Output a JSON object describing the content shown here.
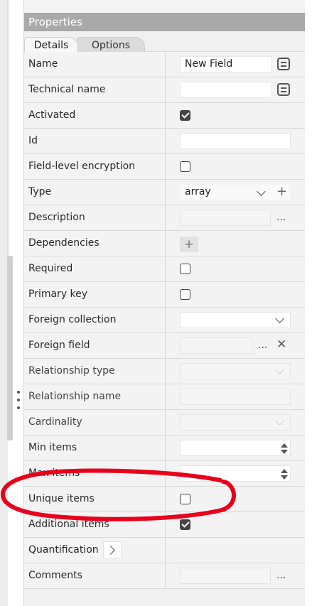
{
  "panel": {
    "title": "Properties",
    "tabs": [
      {
        "label": "Details",
        "active": true
      },
      {
        "label": "Options",
        "active": false
      }
    ]
  },
  "fields": {
    "name": {
      "label": "Name",
      "value": "New Field"
    },
    "technical_name": {
      "label": "Technical name",
      "value": ""
    },
    "activated": {
      "label": "Activated",
      "checked": true
    },
    "id": {
      "label": "Id",
      "value": ""
    },
    "field_level_encryption": {
      "label": "Field-level encryption",
      "checked": false
    },
    "type": {
      "label": "Type",
      "value": "array"
    },
    "description": {
      "label": "Description",
      "value": "",
      "more": "..."
    },
    "dependencies": {
      "label": "Dependencies",
      "add": "+"
    },
    "required": {
      "label": "Required",
      "checked": false
    },
    "primary_key": {
      "label": "Primary key",
      "checked": false
    },
    "foreign_collection": {
      "label": "Foreign collection",
      "value": ""
    },
    "foreign_field": {
      "label": "Foreign field",
      "value": "",
      "more": "..."
    },
    "relationship_type": {
      "label": "Relationship type",
      "value": ""
    },
    "relationship_name": {
      "label": "Relationship name",
      "value": ""
    },
    "cardinality": {
      "label": "Cardinality",
      "value": ""
    },
    "min_items": {
      "label": "Min items",
      "value": ""
    },
    "max_items": {
      "label": "Max items",
      "value": ""
    },
    "unique_items": {
      "label": "Unique items",
      "checked": false
    },
    "additional_items": {
      "label": "Additional items",
      "checked": true
    },
    "quantification": {
      "label": "Quantification"
    },
    "comments": {
      "label": "Comments",
      "value": "",
      "more": "..."
    }
  },
  "colors": {
    "header_bg": "#a9a9a9",
    "annotation_red": "#e8001a"
  },
  "icons": {
    "edit_list": "list-lines-icon",
    "dropdown": "chevron-down-icon",
    "add": "plus-icon",
    "more": "ellipsis-icon",
    "clear": "x-icon",
    "spinner": "spinner-arrows-icon",
    "expand": "chevron-right-icon"
  }
}
